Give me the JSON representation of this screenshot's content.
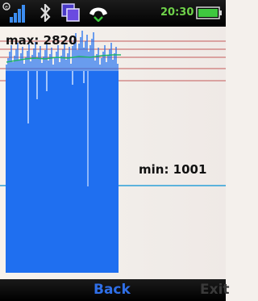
{
  "status_bar": {
    "time": "20:30",
    "icons": [
      "sim-notification-icon",
      "signal-strength-icon",
      "bluetooth-icon",
      "multitask-icon",
      "call-in-progress-icon",
      "battery-full-icon"
    ]
  },
  "graph": {
    "max_label": "max: 2820",
    "min_label": "min: 1001",
    "bar_color": "#1f6ff0",
    "trend_color": "#1fb36a",
    "gridline_color": "#c45a5a",
    "min_line_color": "#2aa0d8"
  },
  "softkeys": {
    "back_label": "Back",
    "exit_label": "Exit"
  }
}
